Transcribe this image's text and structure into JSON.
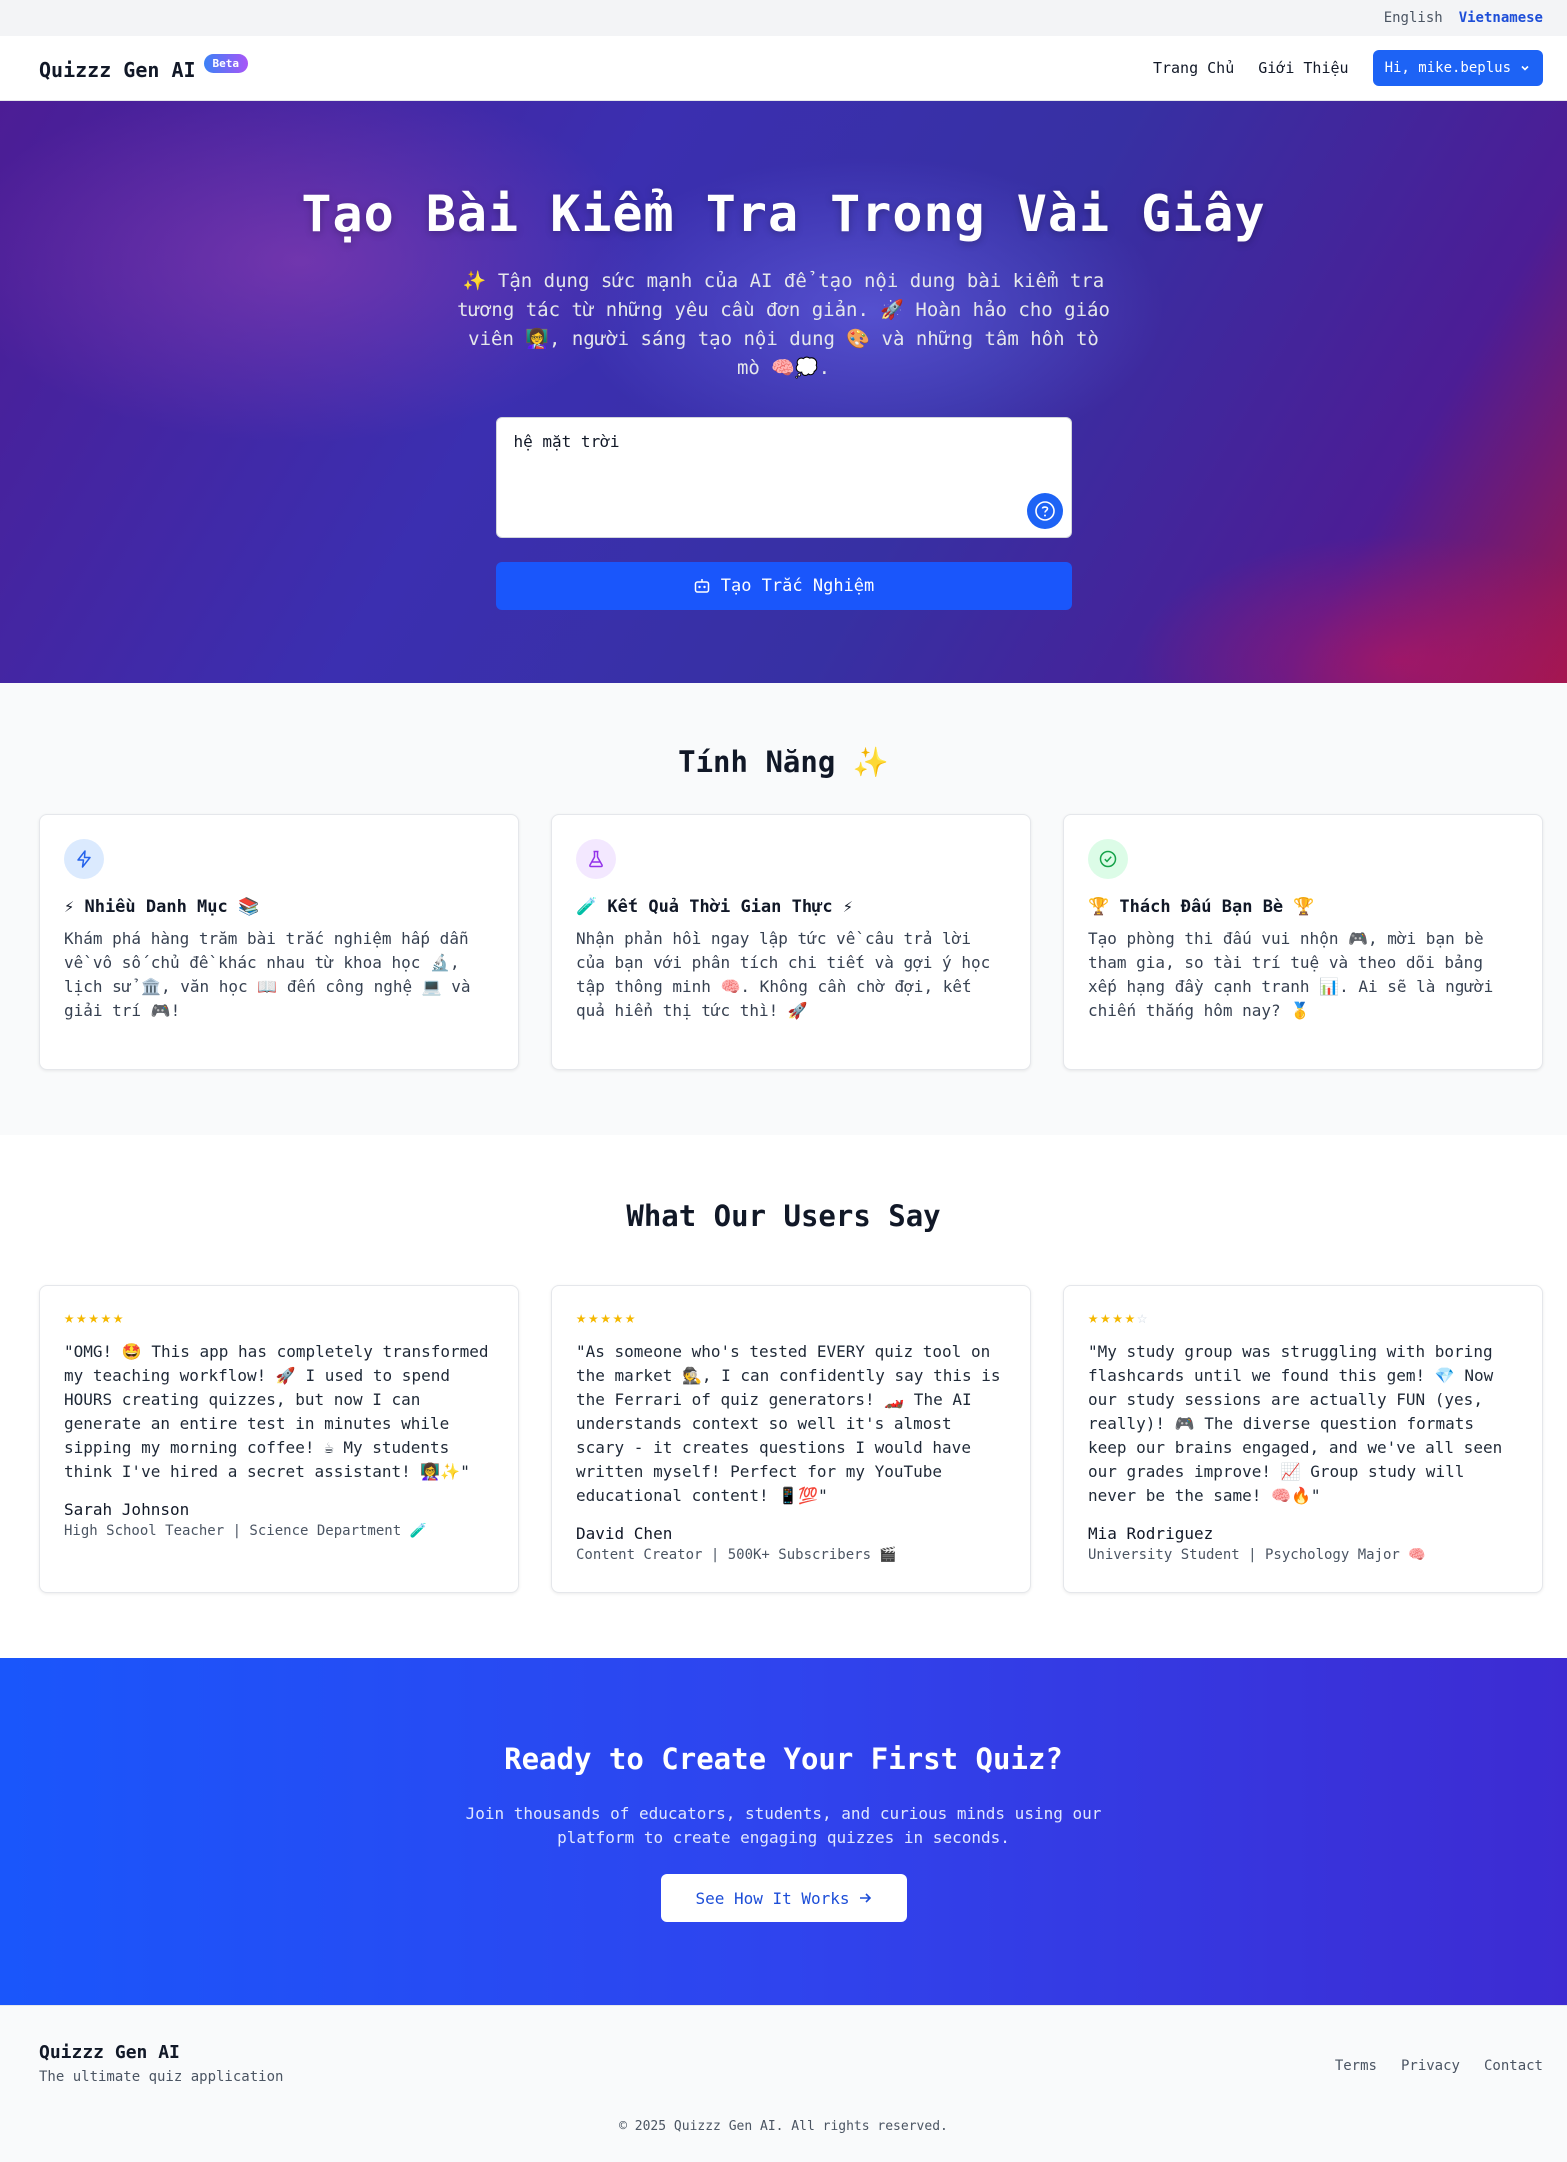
{
  "language": {
    "english": "English",
    "vietnamese": "Vietnamese",
    "active": "Vietnamese"
  },
  "nav": {
    "brand": "Quizzz Gen AI",
    "badge": "Beta",
    "links": [
      "Trang Chủ",
      "Giới Thiệu"
    ],
    "user_button": "Hi, mike.beplus"
  },
  "hero": {
    "title": "Tạo Bài Kiểm Tra Trong Vài Giây",
    "subtitle": "✨ Tận dụng sức mạnh của AI để tạo nội dung bài kiểm tra tương tác từ những yêu cầu đơn giản. 🚀 Hoàn hảo cho giáo viên 👩‍🏫, người sáng tạo nội dung 🎨 và những tâm hồn tò mò 🧠💭.",
    "prompt_value": "hệ mặt trời",
    "generate_button": "Tạo Trắc Nghiệm"
  },
  "features": {
    "title": "Tính Năng ✨",
    "items": [
      {
        "title": "⚡ Nhiều Danh Mục 📚",
        "desc": "Khám phá hàng trăm bài trắc nghiệm hấp dẫn về vô số chủ đề khác nhau từ khoa học 🔬, lịch sử 🏛️, văn học 📖 đến công nghệ 💻 và giải trí 🎮!",
        "icon": "lightning-icon",
        "color": "#dbeafe"
      },
      {
        "title": "🧪 Kết Quả Thời Gian Thực ⚡",
        "desc": "Nhận phản hồi ngay lập tức về câu trả lời của bạn với phân tích chi tiết và gợi ý học tập thông minh 🧠. Không cần chờ đợi, kết quả hiển thị tức thì! 🚀",
        "icon": "flask-icon",
        "color": "#f3e8ff"
      },
      {
        "title": "🏆 Thách Đấu Bạn Bè 🏆",
        "desc": "Tạo phòng thi đấu vui nhộn 🎮, mời bạn bè tham gia, so tài trí tuệ và theo dõi bảng xếp hạng đầy cạnh tranh 📊. Ai sẽ là người chiến thắng hôm nay? 🥇",
        "icon": "check-circle-icon",
        "color": "#dcfce7"
      }
    ]
  },
  "testimonials": {
    "title": "What Our Users Say",
    "items": [
      {
        "rating": 5,
        "quote": "\"OMG! 🤩 This app has completely transformed my teaching workflow! 🚀 I used to spend HOURS creating quizzes, but now I can generate an entire test in minutes while sipping my morning coffee! ☕ My students think I've hired a secret assistant! 👩‍🏫✨\"",
        "name": "Sarah Johnson",
        "role": "High School Teacher | Science Department 🧪"
      },
      {
        "rating": 5,
        "quote": "\"As someone who's tested EVERY quiz tool on the market 🕵️, I can confidently say this is the Ferrari of quiz generators! 🏎️ The AI understands context so well it's almost scary - it creates questions I would have written myself! Perfect for my YouTube educational content! 📱💯\"",
        "name": "David Chen",
        "role": "Content Creator | 500K+ Subscribers 🎬"
      },
      {
        "rating": 4,
        "quote": "\"My study group was struggling with boring flashcards until we found this gem! 💎 Now our study sessions are actually FUN (yes, really)! 🎮 The diverse question formats keep our brains engaged, and we've all seen our grades improve! 📈 Group study will never be the same! 🧠🔥\"",
        "name": "Mia Rodriguez",
        "role": "University Student | Psychology Major 🧠"
      }
    ]
  },
  "cta": {
    "title": "Ready to Create Your First Quiz?",
    "subtitle": "Join thousands of educators, students, and curious minds using our platform to create engaging quizzes in seconds.",
    "button": "See How It Works"
  },
  "footer": {
    "brand": "Quizzz Gen AI",
    "tagline": "The ultimate quiz application",
    "links": [
      "Terms",
      "Privacy",
      "Contact"
    ],
    "copyright": "© 2025 Quizzz Gen AI. All rights reserved."
  }
}
